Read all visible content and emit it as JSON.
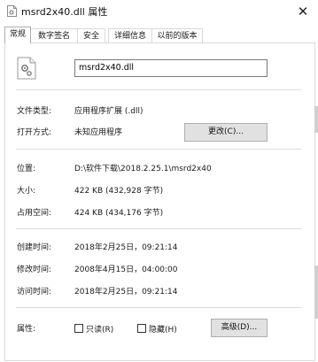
{
  "window": {
    "title": "msrd2x40.dll 属性",
    "close_glyph": "✕"
  },
  "tabs": [
    {
      "label": "常规",
      "active": true
    },
    {
      "label": "数字签名"
    },
    {
      "label": "安全"
    },
    {
      "label": "详细信息"
    },
    {
      "label": "以前的版本"
    }
  ],
  "general": {
    "file_name": "msrd2x40.dll",
    "file_type_label": "文件类型:",
    "file_type_value": "应用程序扩展 (.dll)",
    "open_with_label": "打开方式:",
    "open_with_value": "未知应用程序",
    "change_button": "更改(C)...",
    "location_label": "位置:",
    "location_value": "D:\\软件下载\\2018.2.25.1\\msrd2x40",
    "size_label": "大小:",
    "size_value": "422 KB (432,928 字节)",
    "size_on_disk_label": "占用空间:",
    "size_on_disk_value": "424 KB (434,176 字节)",
    "created_label": "创建时间:",
    "created_value": "2018年2月25日，09:21:14",
    "modified_label": "修改时间:",
    "modified_value": "2008年4月15日，04:00:00",
    "accessed_label": "访问时间:",
    "accessed_value": "2018年2月25日，09:21:14",
    "attributes_label": "属性:",
    "readonly_label": "只读(R)",
    "readonly_checked": false,
    "hidden_label": "隐藏(H)",
    "hidden_checked": false,
    "advanced_button": "高级(D)..."
  },
  "icons": {
    "title": "dll-file-icon",
    "file": "dll-gear-file-icon"
  }
}
